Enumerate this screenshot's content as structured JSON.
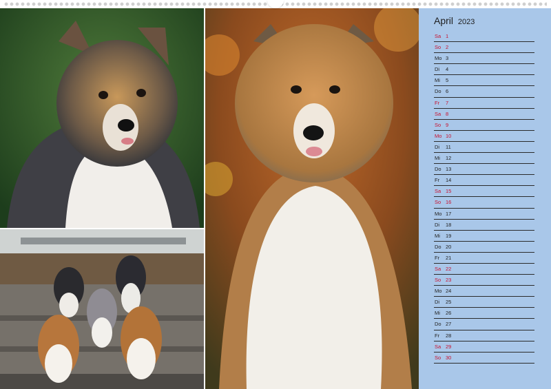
{
  "calendar": {
    "month": "April",
    "year": "2023",
    "highlight_color": "#c8102e",
    "sidebar_color": "#a9c7e9",
    "days": [
      {
        "wd": "Sa",
        "d": "1",
        "hl": true
      },
      {
        "wd": "So",
        "d": "2",
        "hl": true
      },
      {
        "wd": "Mo",
        "d": "3",
        "hl": false
      },
      {
        "wd": "Di",
        "d": "4",
        "hl": false
      },
      {
        "wd": "Mi",
        "d": "5",
        "hl": false
      },
      {
        "wd": "Do",
        "d": "6",
        "hl": false
      },
      {
        "wd": "Fr",
        "d": "7",
        "hl": true
      },
      {
        "wd": "Sa",
        "d": "8",
        "hl": true
      },
      {
        "wd": "So",
        "d": "9",
        "hl": true
      },
      {
        "wd": "Mo",
        "d": "10",
        "hl": true
      },
      {
        "wd": "Di",
        "d": "11",
        "hl": false
      },
      {
        "wd": "Mi",
        "d": "12",
        "hl": false
      },
      {
        "wd": "Do",
        "d": "13",
        "hl": false
      },
      {
        "wd": "Fr",
        "d": "14",
        "hl": false
      },
      {
        "wd": "Sa",
        "d": "15",
        "hl": true
      },
      {
        "wd": "So",
        "d": "16",
        "hl": true
      },
      {
        "wd": "Mo",
        "d": "17",
        "hl": false
      },
      {
        "wd": "Di",
        "d": "18",
        "hl": false
      },
      {
        "wd": "Mi",
        "d": "19",
        "hl": false
      },
      {
        "wd": "Do",
        "d": "20",
        "hl": false
      },
      {
        "wd": "Fr",
        "d": "21",
        "hl": false
      },
      {
        "wd": "Sa",
        "d": "22",
        "hl": true
      },
      {
        "wd": "So",
        "d": "23",
        "hl": true
      },
      {
        "wd": "Mo",
        "d": "24",
        "hl": false
      },
      {
        "wd": "Di",
        "d": "25",
        "hl": false
      },
      {
        "wd": "Mi",
        "d": "26",
        "hl": false
      },
      {
        "wd": "Do",
        "d": "27",
        "hl": false
      },
      {
        "wd": "Fr",
        "d": "28",
        "hl": false
      },
      {
        "wd": "Sa",
        "d": "29",
        "hl": true
      },
      {
        "wd": "So",
        "d": "30",
        "hl": true
      }
    ]
  }
}
